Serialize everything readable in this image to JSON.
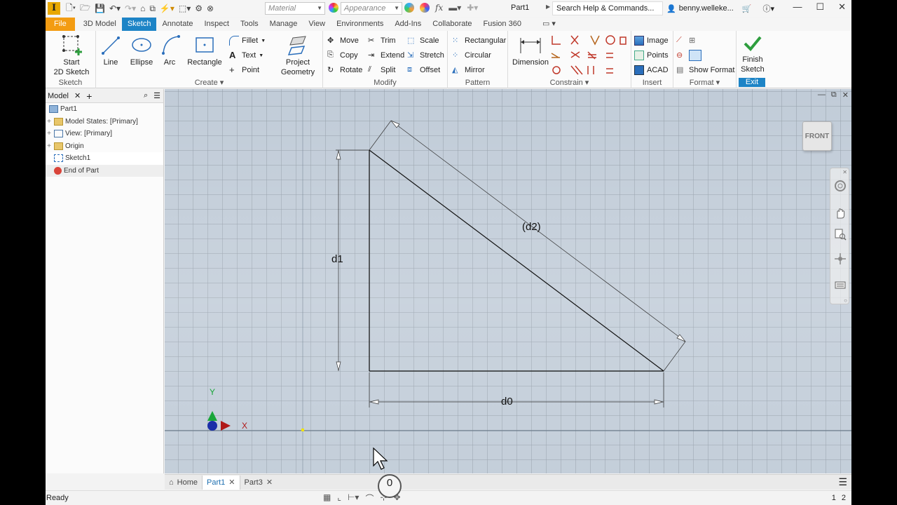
{
  "app": {
    "logo_letter": "I",
    "document_title": "Part1",
    "search_placeholder": "Search Help & Commands...",
    "user": "benny.welleke...",
    "material_placeholder": "Material",
    "appearance_placeholder": "Appearance"
  },
  "ribbon_tabs": [
    "File",
    "3D Model",
    "Sketch",
    "Annotate",
    "Inspect",
    "Tools",
    "Manage",
    "View",
    "Environments",
    "Add-Ins",
    "Collaborate",
    "Fusion 360"
  ],
  "active_tab": "Sketch",
  "ribbon": {
    "sketch_panel": {
      "label": "Sketch",
      "start_line1": "Start",
      "start_line2": "2D Sketch"
    },
    "create_panel": {
      "label": "Create",
      "line": "Line",
      "ellipse": "Ellipse",
      "arc": "Arc",
      "rectangle": "Rectangle",
      "fillet": "Fillet",
      "text": "Text",
      "point": "Point",
      "project_line1": "Project",
      "project_line2": "Geometry"
    },
    "modify_panel": {
      "label": "Modify",
      "move": "Move",
      "copy": "Copy",
      "rotate": "Rotate",
      "trim": "Trim",
      "extend": "Extend",
      "split": "Split",
      "scale": "Scale",
      "stretch": "Stretch",
      "offset": "Offset"
    },
    "pattern_panel": {
      "label": "Pattern",
      "rectangular": "Rectangular",
      "circular": "Circular",
      "mirror": "Mirror"
    },
    "constrain_panel": {
      "label": "Constrain",
      "dimension": "Dimension"
    },
    "insert_panel": {
      "label": "Insert",
      "image": "Image",
      "points": "Points",
      "acad": "ACAD"
    },
    "format_panel": {
      "label": "Format",
      "show_format": "Show Format"
    },
    "exit_panel": {
      "label": "Exit",
      "finish_line1": "Finish",
      "finish_line2": "Sketch"
    }
  },
  "browser": {
    "tab_label": "Model",
    "items": [
      {
        "label": "Part1",
        "icon": "part-icon"
      },
      {
        "label": "Model States: [Primary]",
        "icon": "folder-icon"
      },
      {
        "label": "View: [Primary]",
        "icon": "view-icon"
      },
      {
        "label": "Origin",
        "icon": "folder-icon"
      },
      {
        "label": "Sketch1",
        "icon": "sketch-icon"
      },
      {
        "label": "End of Part",
        "icon": "end-of-part-icon"
      }
    ]
  },
  "viewport": {
    "viewcube_label": "FRONT",
    "dimensions": {
      "d0": "d0",
      "d1": "d1",
      "d2": "(d2)"
    },
    "axis_x": "X",
    "axis_y": "Y",
    "cursor_badge": "0"
  },
  "doc_tabs": [
    {
      "label": "Home"
    },
    {
      "label": "Part1",
      "active": true
    },
    {
      "label": "Part3"
    }
  ],
  "status": {
    "text": "Ready",
    "page1": "1",
    "page2": "2"
  },
  "colors": {
    "accent": "#1d84c6",
    "file_tab": "#f39c12",
    "finish_check": "#2e9e3e"
  }
}
